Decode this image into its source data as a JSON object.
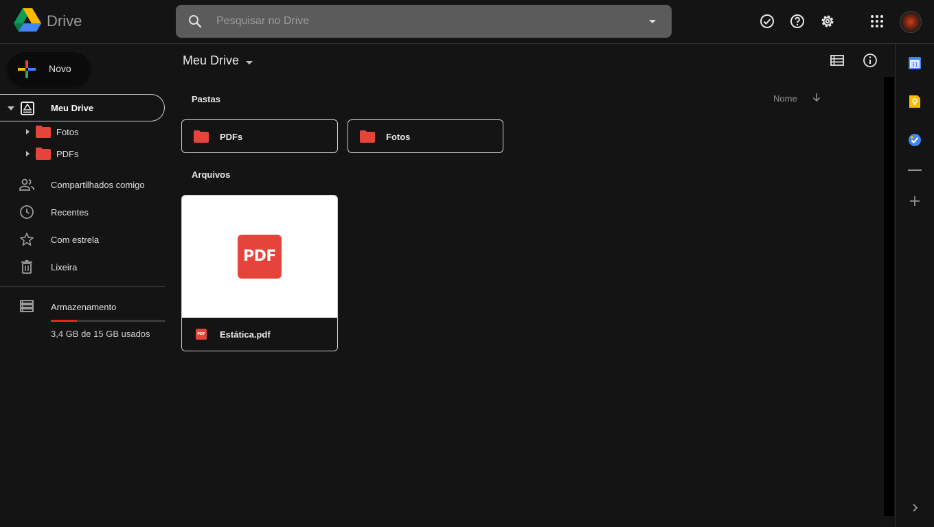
{
  "header": {
    "brand": "Drive",
    "search_placeholder": "Pesquisar no Drive",
    "icons": [
      "ready-offline-icon",
      "help-icon",
      "settings-icon",
      "apps-grid-icon",
      "account-avatar"
    ]
  },
  "sidebar": {
    "new_label": "Novo",
    "my_drive": "Meu Drive",
    "tree": [
      {
        "label": "Fotos"
      },
      {
        "label": "PDFs"
      }
    ],
    "items": [
      {
        "label": "Compartilhados comigo",
        "icon": "people-icon"
      },
      {
        "label": "Recentes",
        "icon": "clock-icon"
      },
      {
        "label": "Com estrela",
        "icon": "star-icon"
      },
      {
        "label": "Lixeira",
        "icon": "trash-icon"
      }
    ],
    "storage": {
      "label": "Armazenamento",
      "used_text": "3,4 GB de 15 GB usados",
      "used_fraction": 0.227
    }
  },
  "main": {
    "breadcrumb": "Meu Drive",
    "folders_title": "Pastas",
    "sort_label": "Nome",
    "folders": [
      {
        "label": "PDFs"
      },
      {
        "label": "Fotos"
      }
    ],
    "files_title": "Arquivos",
    "files": [
      {
        "name": "Estática.pdf",
        "thumb_text": "PDF",
        "icon_text": "PDF"
      }
    ]
  },
  "colors": {
    "background": "#141414",
    "folder_red": "#e5443b",
    "storage_bar": "#e8221c",
    "search_bg": "#5b5b5b"
  }
}
